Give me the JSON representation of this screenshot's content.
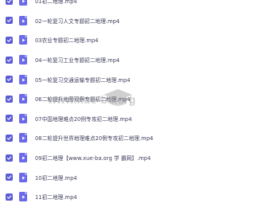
{
  "files": [
    {
      "name": "01初二地理.mp4"
    },
    {
      "name": "02一轮复习人文专题初二地理.mp4"
    },
    {
      "name": "03农业专题初二地理.mp4"
    },
    {
      "name": "04一轮复习工业专题初二地理.mp4"
    },
    {
      "name": "05一轮复习交通运输专题初二地理.mp4"
    },
    {
      "name": "06二轮提升地图观察专题初二地理.mp4"
    },
    {
      "name": "07中国地理难点20例专攻初二地理.mp4"
    },
    {
      "name": "08二轮提升世界地理难点20例专攻初二地理.mp4"
    },
    {
      "name": "09初二地理【www.xue-ba.org 学 霸网】.mp4"
    },
    {
      "name": "10初二地理.mp4"
    },
    {
      "name": "11初二地理.mp4"
    }
  ],
  "watermark": {
    "text": "www.xue-ba.org"
  },
  "colors": {
    "checkbox": "#5b5bd6",
    "file_icon": "#6a6aea"
  }
}
